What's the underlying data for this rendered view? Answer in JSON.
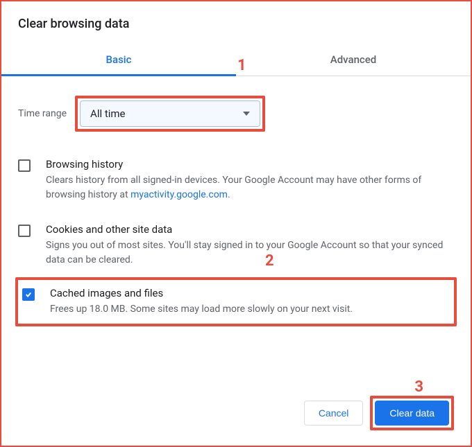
{
  "dialog": {
    "title": "Clear browsing data"
  },
  "tabs": {
    "basic": "Basic",
    "advanced": "Advanced"
  },
  "timeRange": {
    "label": "Time range",
    "value": "All time"
  },
  "options": {
    "browsingHistory": {
      "title": "Browsing history",
      "desc_pre": "Clears history from all signed-in devices. Your Google Account may have other forms of browsing history at ",
      "link": "myactivity.google.com",
      "desc_post": ".",
      "checked": false
    },
    "cookies": {
      "title": "Cookies and other site data",
      "desc": "Signs you out of most sites. You'll stay signed in to your Google Account so that your synced data can be cleared.",
      "checked": false
    },
    "cache": {
      "title": "Cached images and files",
      "desc": "Frees up 18.0 MB. Some sites may load more slowly on your next visit.",
      "checked": true
    }
  },
  "buttons": {
    "cancel": "Cancel",
    "clear": "Clear data"
  },
  "annotations": {
    "a1": "1",
    "a2": "2",
    "a3": "3"
  }
}
